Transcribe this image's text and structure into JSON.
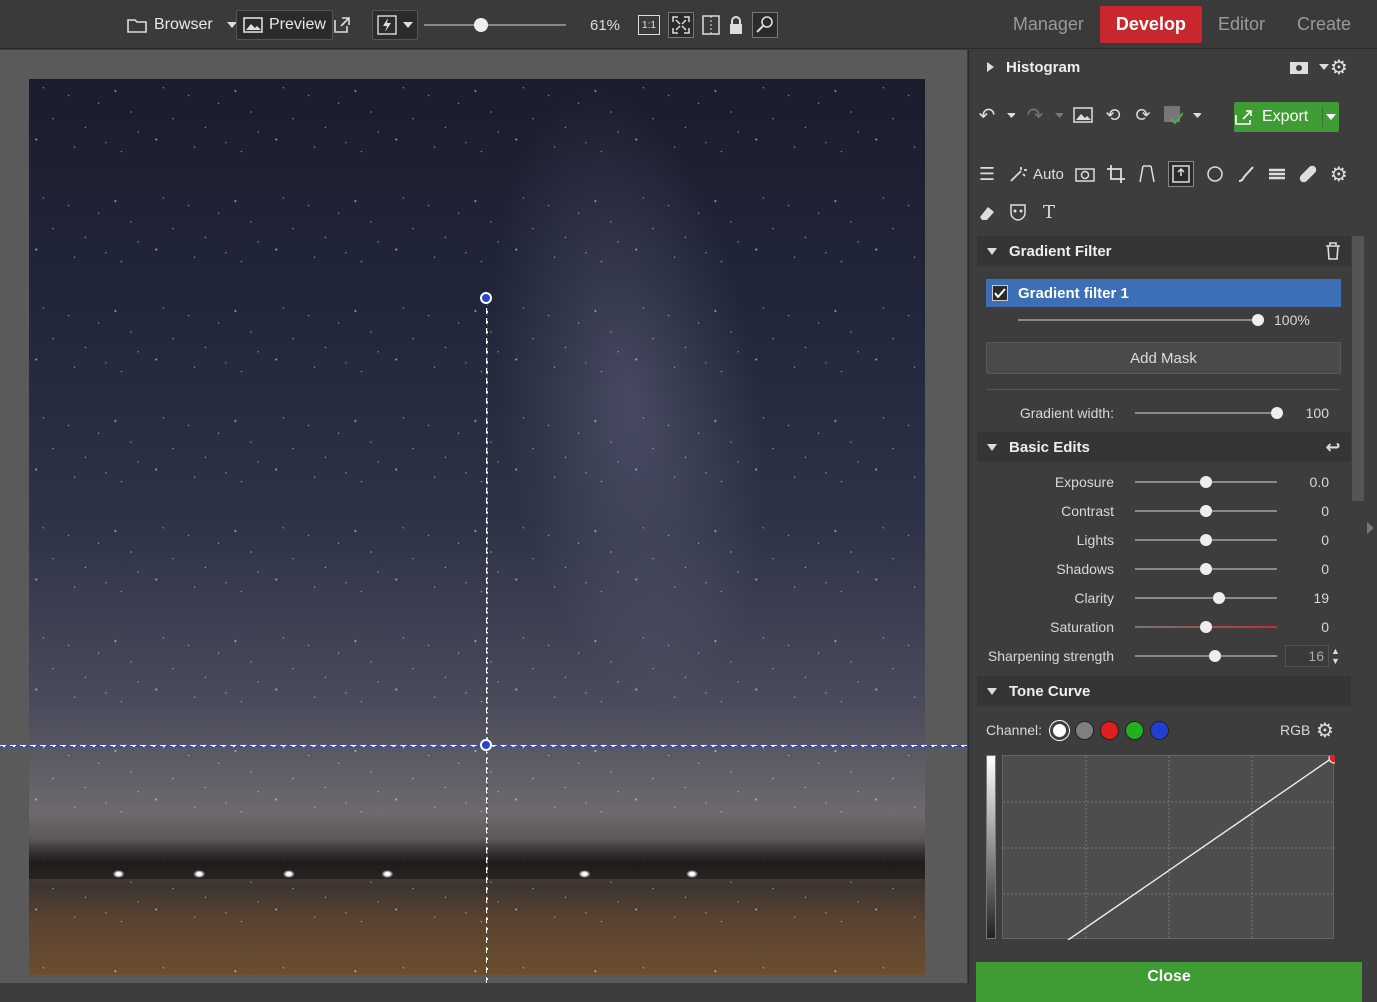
{
  "topbar": {
    "browser_label": "Browser",
    "preview_label": "Preview",
    "zoom_value": "61%",
    "zoom_slider_fraction": 0.4,
    "one_to_one": "1:1",
    "modes": [
      "Manager",
      "Develop",
      "Editor",
      "Create"
    ],
    "active_mode": "Develop"
  },
  "panel": {
    "histogram_title": "Histogram",
    "export_label": "Export",
    "auto_label": "Auto",
    "gradient_filter": {
      "title": "Gradient Filter",
      "item_label": "Gradient filter 1",
      "item_checked": true,
      "opacity_value": "100%",
      "opacity_fraction": 1.0,
      "add_mask_label": "Add Mask",
      "gradient_width_label": "Gradient width:",
      "gradient_width_value": "100",
      "gradient_width_fraction": 1.0
    },
    "basic_edits": {
      "title": "Basic Edits",
      "rows": [
        {
          "label": "Exposure",
          "value": "0.0",
          "fraction": 0.5
        },
        {
          "label": "Contrast",
          "value": "0",
          "fraction": 0.5
        },
        {
          "label": "Lights",
          "value": "0",
          "fraction": 0.5
        },
        {
          "label": "Shadows",
          "value": "0",
          "fraction": 0.5
        },
        {
          "label": "Clarity",
          "value": "19",
          "fraction": 0.59
        },
        {
          "label": "Saturation",
          "value": "0",
          "fraction": 0.5
        },
        {
          "label": "Sharpening strength",
          "value": "16",
          "fraction": 0.56
        }
      ]
    },
    "tone_curve": {
      "title": "Tone Curve",
      "channel_label": "Channel:",
      "channel_mode": "RGB",
      "channel_colors": [
        "#ffffff",
        "#808080",
        "#e02020",
        "#20b020",
        "#2040d0"
      ]
    },
    "close_label": "Close"
  }
}
